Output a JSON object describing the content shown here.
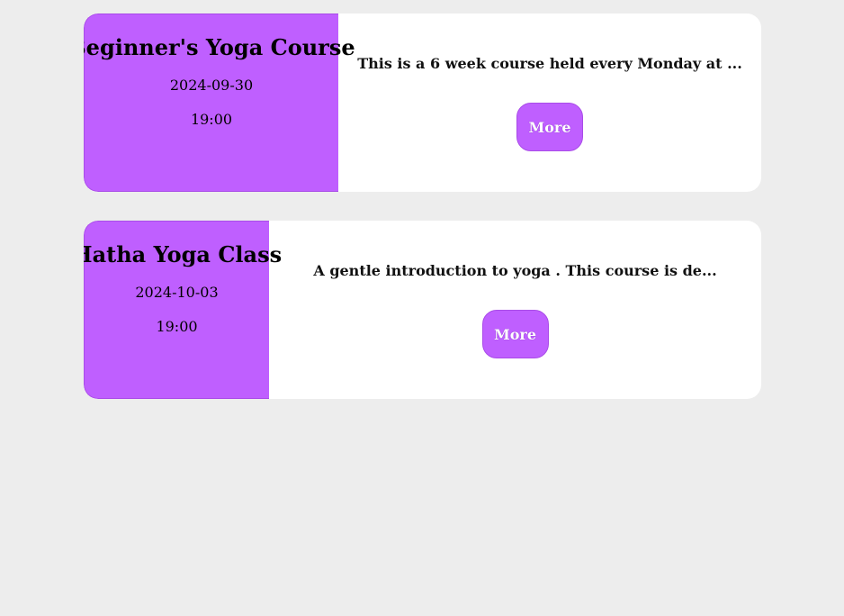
{
  "courses": [
    {
      "title": "Beginner's Yoga Course",
      "date": "2024-09-30",
      "time": "19:00",
      "description": "This is a 6 week course held every Monday at ...",
      "button_label": "More"
    },
    {
      "title": "Hatha Yoga Class",
      "date": "2024-10-03",
      "time": "19:00",
      "description": "A gentle introduction to yoga . This course is de...",
      "button_label": "More"
    }
  ],
  "colors": {
    "accent": "#bf5fff",
    "background": "#ededed",
    "card": "#ffffff"
  }
}
